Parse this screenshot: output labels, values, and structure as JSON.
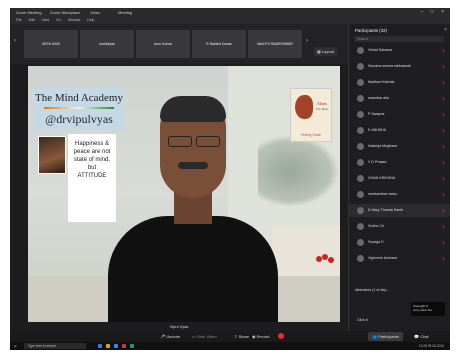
{
  "window": {
    "tabs": [
      "Zoom Meeting",
      "Zoom Workplace",
      "Video",
      "Meeting"
    ],
    "menu": [
      "File",
      "Edit",
      "View",
      "Go",
      "Window",
      "Help"
    ]
  },
  "strip": {
    "thumbs": [
      "ARYA HARI",
      "sushidipta",
      "Arun Kumar",
      "R Rakshit Kumar",
      "MAATHI RAMESHWAR"
    ],
    "layout_label": "Layout"
  },
  "slide": {
    "academy_title": "The Mind Academy",
    "handle": "@drvipulvyas",
    "quote": [
      "Happiness &",
      "peace are not",
      "state of mind,",
      "but",
      "ATTITUDE"
    ],
    "mann_title": "Mann",
    "mann_sub": "The Mind",
    "mann_caption": "Feeling Good!"
  },
  "speaker_name": "Vipul Vyas",
  "toolbar": {
    "unmute": "Unmute",
    "start_video": "Start Video",
    "share": "Share",
    "record": "Record",
    "participants": "Participants",
    "chat": "Chat"
  },
  "panel": {
    "title": "Participants (32)",
    "search_placeholder": "Search",
    "participants": [
      "Vishal Sahasra",
      "Sumana seema rabhaavali",
      "Madhavi Kalvala",
      "manohar alla",
      "P Swapna",
      "K ANUSHA",
      "Nakireja Meghana",
      "V D Prasad",
      "CHAN KRISHNA",
      "sreekanthan babu",
      "D Mary Thanda Santh",
      "Sudha Ch",
      "Swarga S",
      "Vighnesh Archana"
    ],
    "attendees_header": "Attendees (1 of dep...",
    "tooltip": [
      "Sreenghi S",
      "sorry clear the"
    ],
    "click_row": "Click it",
    "accent": "#d33b3b"
  },
  "taskbar": {
    "search_placeholder": "Type here to search",
    "time": "10:28",
    "date": "09-05-2024"
  }
}
